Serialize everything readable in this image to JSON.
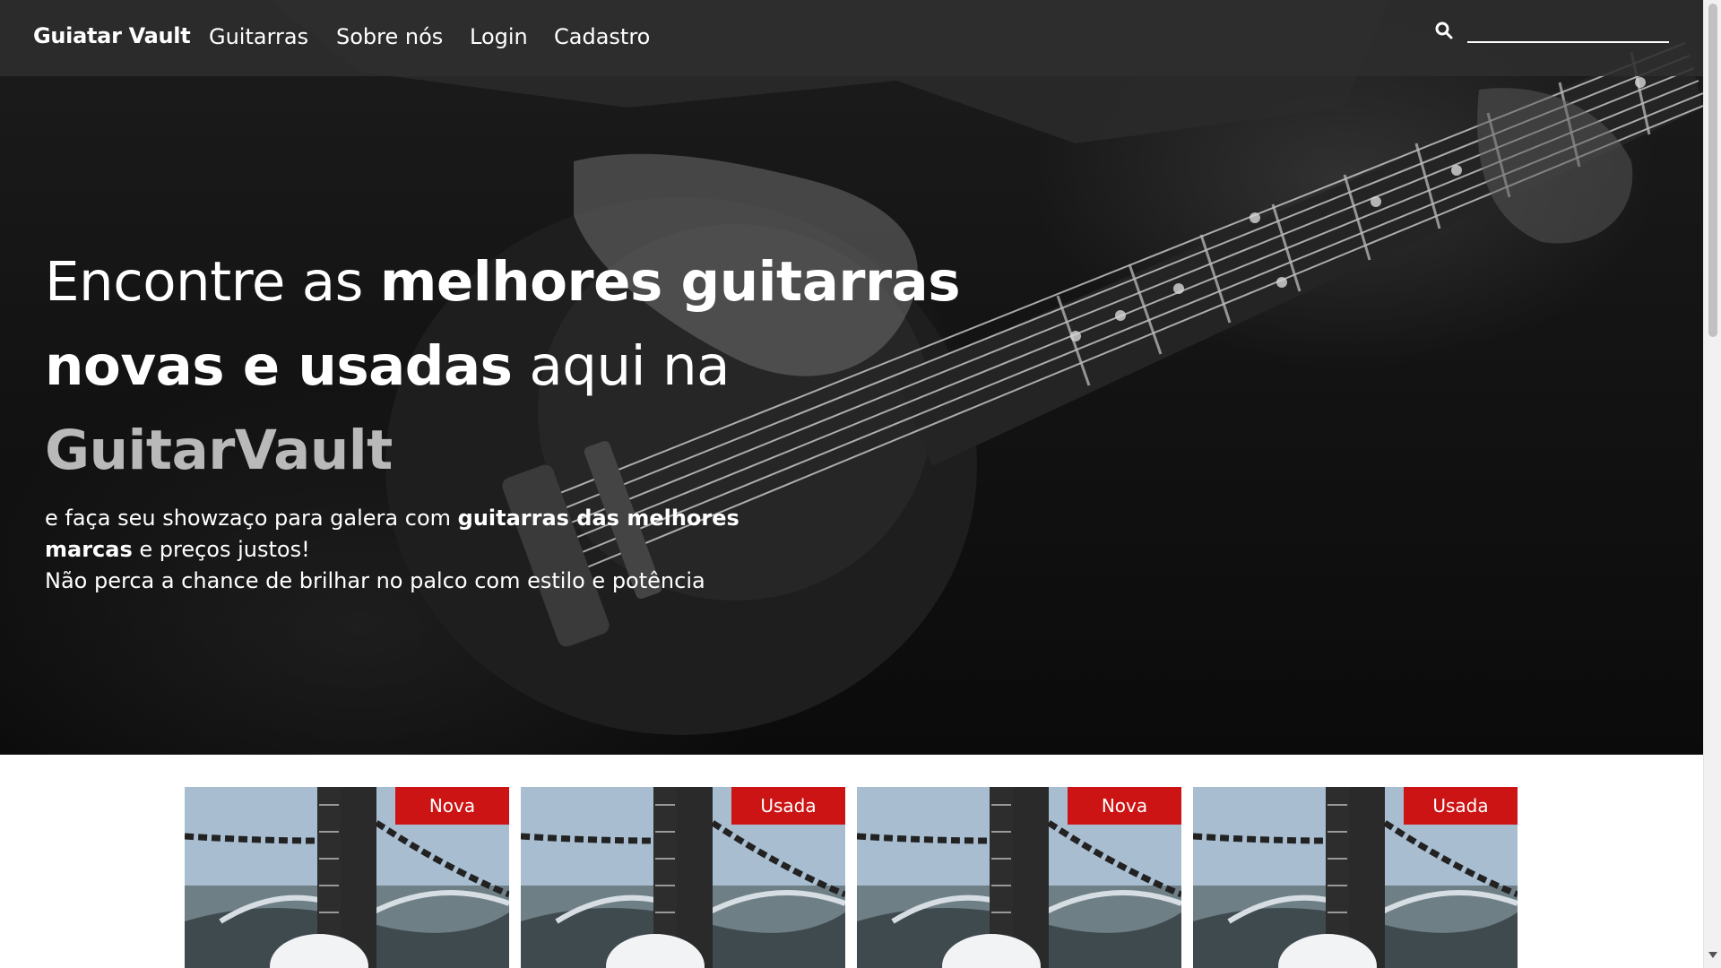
{
  "navbar": {
    "brand": "Guiatar Vault",
    "links": [
      "Guitarras",
      "Sobre nós",
      "Login",
      "Cadastro"
    ],
    "search": {
      "placeholder": "",
      "icon": "search-icon"
    }
  },
  "hero": {
    "title_part1": "Encontre as ",
    "title_bold1": "melhores guitarras",
    "title_bold2": "novas e usadas",
    "title_part2": " aqui na",
    "title_brand": "GuitarVault",
    "sub_part1": "e faça seu showzaço para galera com ",
    "sub_bold1": "guitarras das melhores marcas",
    "sub_part2": " e preços justos!",
    "sub_line2": "Não perca a chance de brilhar no palco com estilo e potência"
  },
  "products": [
    {
      "badge": "Nova"
    },
    {
      "badge": "Usada"
    },
    {
      "badge": "Nova"
    },
    {
      "badge": "Usada"
    }
  ],
  "colors": {
    "badge": "#cc1414",
    "navbar": "#2d2d2d",
    "brand_accent": "#b9b9b9"
  }
}
